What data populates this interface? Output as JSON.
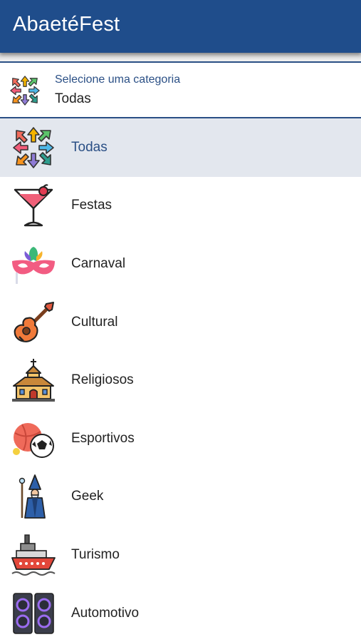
{
  "app": {
    "title": "AbaetéFest"
  },
  "selector": {
    "hint": "Selecione uma categoria",
    "value": "Todas",
    "icon": "all-directions-arrows-icon"
  },
  "categories": [
    {
      "label": "Todas",
      "icon": "all-directions-arrows-icon",
      "selected": true
    },
    {
      "label": "Festas",
      "icon": "cocktail-glass-icon",
      "selected": false
    },
    {
      "label": "Carnaval",
      "icon": "carnival-mask-icon",
      "selected": false
    },
    {
      "label": "Cultural",
      "icon": "guitar-icon",
      "selected": false
    },
    {
      "label": "Religiosos",
      "icon": "church-icon",
      "selected": false
    },
    {
      "label": "Esportivos",
      "icon": "sports-balls-icon",
      "selected": false
    },
    {
      "label": "Geek",
      "icon": "wizard-icon",
      "selected": false
    },
    {
      "label": "Turismo",
      "icon": "ship-icon",
      "selected": false
    },
    {
      "label": "Automotivo",
      "icon": "speakers-icon",
      "selected": false
    }
  ],
  "colors": {
    "appbar": "#1f4d8b",
    "accent": "#2a4f85",
    "selected_row": "#e3e7ee"
  }
}
